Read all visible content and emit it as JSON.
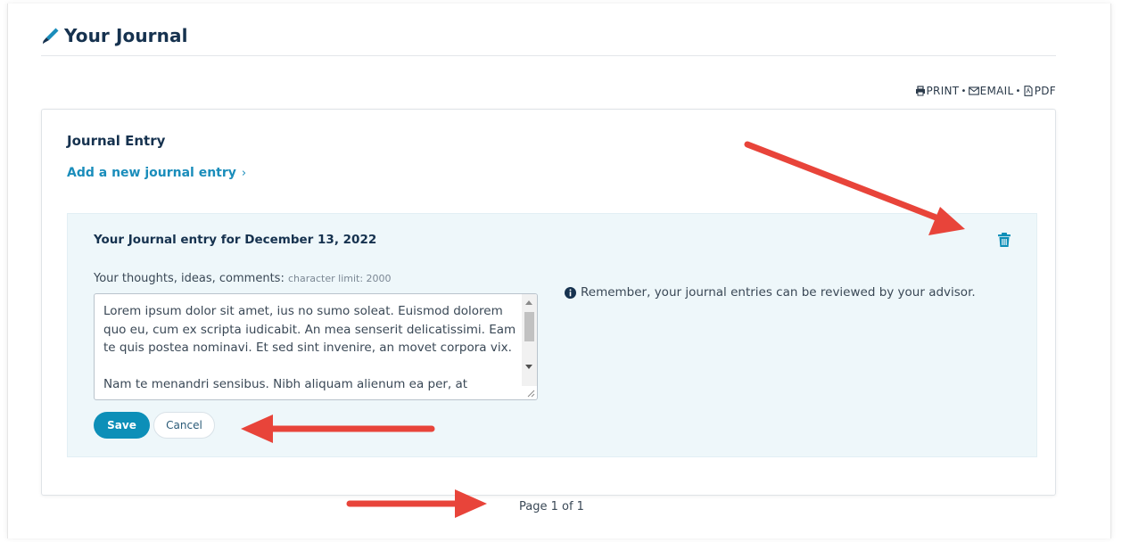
{
  "page": {
    "title": "Your Journal",
    "icon": "pen-icon"
  },
  "share": {
    "print": "PRINT",
    "email": "EMAIL",
    "pdf": "PDF",
    "separator": "•"
  },
  "card": {
    "title": "Journal Entry",
    "add_link": "Add a new journal entry",
    "add_link_chevron": "›"
  },
  "entry": {
    "heading": "Your Journal entry for December 13, 2022",
    "field_label": "Your thoughts, ideas, comments:",
    "char_limit": "character limit: 2000",
    "paragraph_1": "Lorem ipsum dolor sit amet, ius no sumo soleat. Euismod dolorem quo eu, cum ex scripta iudicabit. An mea senserit delicatissimi. Eam te quis postea nominavi. Et sed sint invenire, an movet corpora vix.",
    "paragraph_2": "Nam te menandri sensibus. Nibh aliquam alienum ea per, at",
    "save_label": "Save",
    "cancel_label": "Cancel",
    "reminder": "Remember, your journal entries can be reviewed by your advisor."
  },
  "pagination": {
    "label": "Page 1 of 1"
  },
  "colors": {
    "accent": "#0d8fb8",
    "link": "#1a8dbb",
    "title": "#16324f",
    "panel_bg": "#eef7fa",
    "annotation_arrow": "#e8443a"
  }
}
